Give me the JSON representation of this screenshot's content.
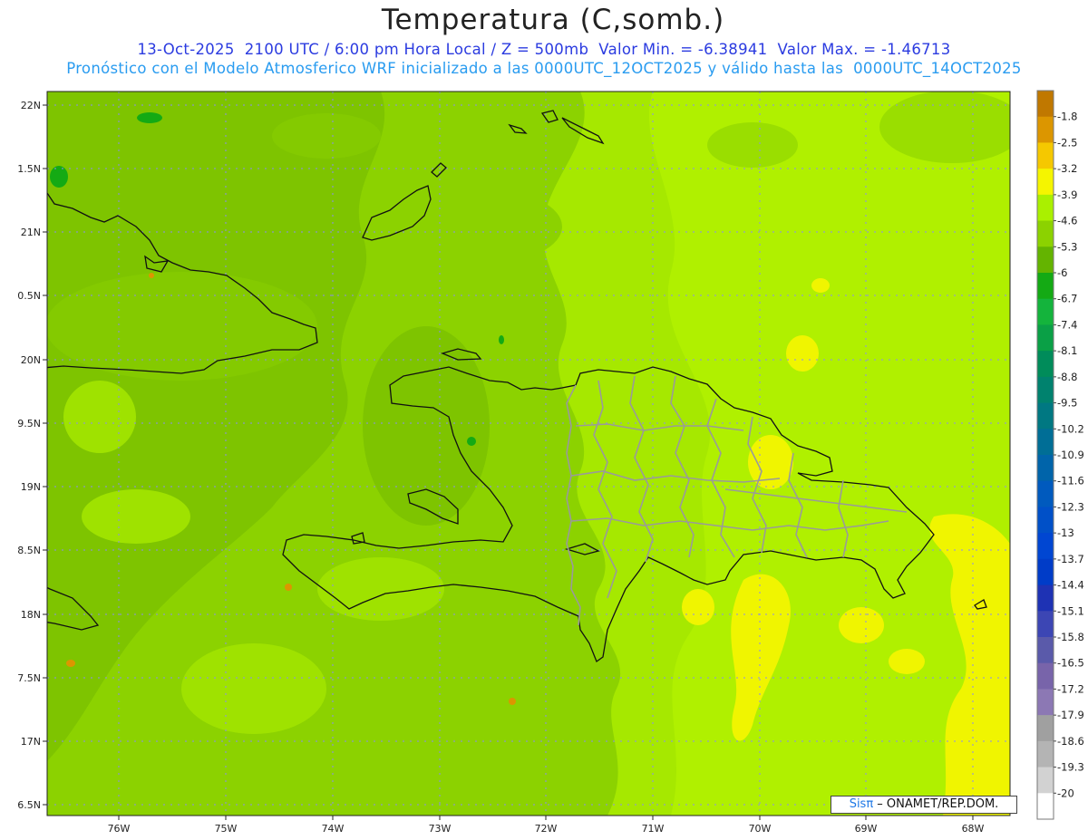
{
  "header": {
    "title": "Temperatura (C,somb.)",
    "line1": "13-Oct-2025  2100 UTC / 6:00 pm Hora Local / Z = 500mb  Valor Min. = -6.38941  Valor Max. = -1.46713",
    "line2": "Pronóstico con el Modelo Atmosferico WRF inicializado a las 0000UTC_12OCT2025 y válido hasta las  0000UTC_14OCT2025"
  },
  "axes": {
    "x_ticks": [
      "76W",
      "75W",
      "74W",
      "73W",
      "72W",
      "71W",
      "70W",
      "69W",
      "68W"
    ],
    "y_ticks": [
      "22N",
      "1.5N",
      "21N",
      "0.5N",
      "20N",
      "9.5N",
      "19N",
      "8.5N",
      "18N",
      "7.5N",
      "17N",
      "6.5N"
    ]
  },
  "colorbar": {
    "labels": [
      "-1.8",
      "-2.5",
      "-3.2",
      "-3.9",
      "-4.6",
      "-5.3",
      "-6",
      "-6.7",
      "-7.4",
      "-8.1",
      "-8.8",
      "-9.5",
      "-10.2",
      "-10.9",
      "-11.6",
      "-12.3",
      "-13",
      "-13.7",
      "-14.4",
      "-15.1",
      "-15.8",
      "-16.5",
      "-17.2",
      "-17.9",
      "-18.6",
      "-19.3",
      "-20"
    ],
    "colors": [
      "#c07800",
      "#dc9600",
      "#f5c800",
      "#f5f500",
      "#aaf000",
      "#8cd200",
      "#64b400",
      "#14aa14",
      "#14b43c",
      "#0aa046",
      "#008c5a",
      "#00826e",
      "#007882",
      "#006e96",
      "#0064aa",
      "#005abe",
      "#0050c8",
      "#0046d2",
      "#003cc8",
      "#1e32b4",
      "#3c46b4",
      "#5a5aaa",
      "#7864aa",
      "#8c78b4",
      "#a0a0a0",
      "#b4b4b4",
      "#d2d2d2",
      "#ffffff"
    ]
  },
  "credit": {
    "logo": "Sisπ",
    "text": " – ONAMET/REP.DOM."
  }
}
